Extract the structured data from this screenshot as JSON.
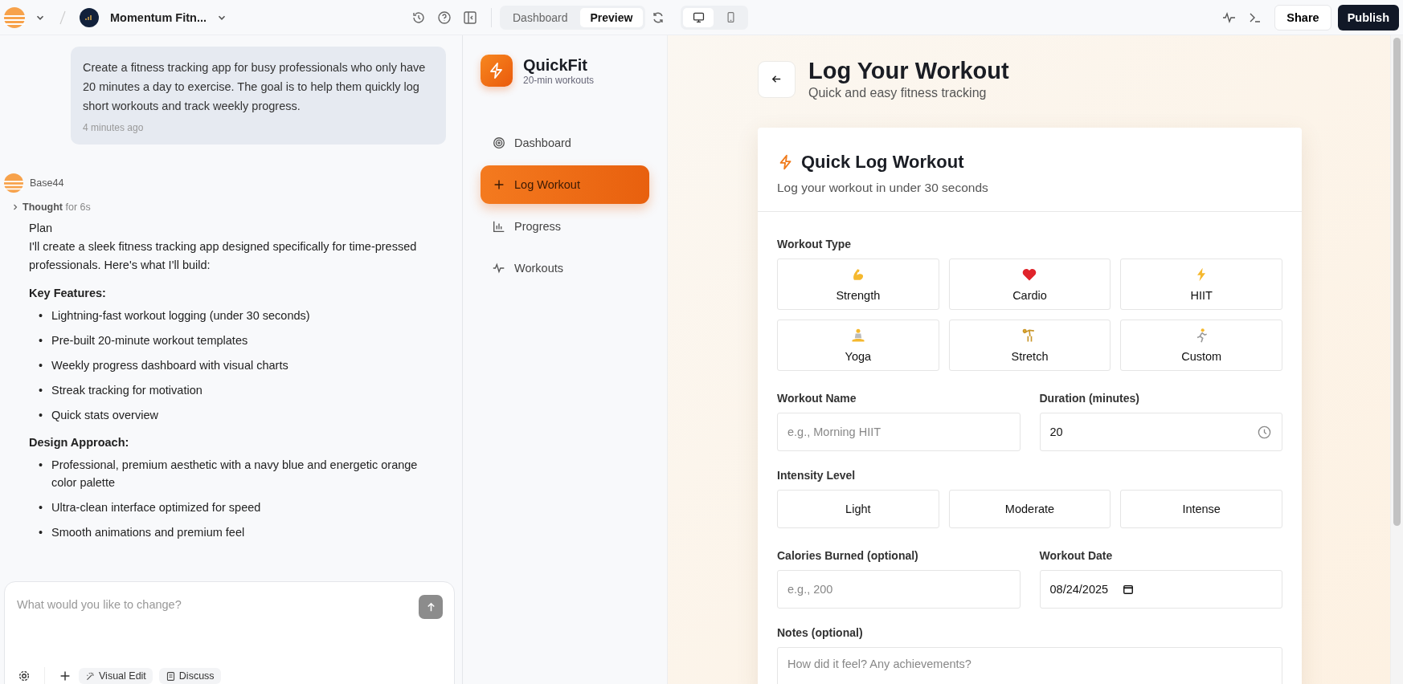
{
  "topbar": {
    "project": "Momentum Fitn...",
    "view_tabs": [
      {
        "label": "Dashboard",
        "selected": false
      },
      {
        "label": "Preview",
        "selected": true
      }
    ],
    "devices": [
      {
        "kind": "desktop",
        "selected": true
      },
      {
        "kind": "mobile",
        "selected": false
      }
    ],
    "share": "Share",
    "publish": "Publish"
  },
  "chat": {
    "user_message": "Create a fitness tracking app for busy professionals who only have 20 minutes a day to exercise. The goal is to help them quickly log short workouts and track weekly progress.",
    "time": "4 minutes ago",
    "assistant": "Base44",
    "thought": "**Thought** for 6s",
    "blocks": [
      {
        "kind": "text",
        "text": "Plan"
      },
      {
        "kind": "text",
        "text": "I'll create a sleek fitness tracking app designed specifically for time-pressed professionals. Here's what I'll build:"
      },
      {
        "kind": "heading",
        "text": "Key Features:"
      },
      {
        "kind": "bullets",
        "marker": "•",
        "items": [
          "Lightning-fast workout logging (under 30 seconds)",
          "Pre-built 20-minute workout templates",
          "Weekly progress dashboard with visual charts",
          "Streak tracking for motivation",
          "Quick stats overview"
        ]
      },
      {
        "kind": "heading",
        "text": "Design Approach:"
      },
      {
        "kind": "bullets",
        "marker": "•",
        "items": [
          "Professional, premium aesthetic with a navy blue and energetic orange color palette",
          "Ultra-clean interface optimized for speed",
          "Smooth animations and premium feel"
        ]
      }
    ],
    "input_placeholder": "What would you like to change?",
    "tools": [
      "Visual Edit",
      "Discuss"
    ]
  },
  "app": {
    "name": "QuickFit",
    "tagline": "20-min workouts",
    "nav": [
      {
        "kind": "target",
        "label": "Dashboard",
        "selected": false
      },
      {
        "kind": "plus",
        "label": "Log Workout",
        "selected": true
      },
      {
        "kind": "chart",
        "label": "Progress",
        "selected": false
      },
      {
        "kind": "activity",
        "label": "Workouts",
        "selected": false
      }
    ],
    "page_title": "Log Your Workout",
    "page_subtitle": "Quick and easy fitness tracking",
    "card": {
      "title": "Quick Log Workout",
      "subtitle": "Log your workout in under 30 seconds",
      "workout_type": {
        "label": "Workout Type",
        "options": [
          {
            "kind": "muscle",
            "label": "Strength",
            "selected": false
          },
          {
            "kind": "heart",
            "label": "Cardio",
            "selected": false
          },
          {
            "kind": "bolt",
            "label": "HIIT",
            "selected": false
          },
          {
            "kind": "yoga",
            "label": "Yoga",
            "selected": false
          },
          {
            "kind": "cartwheel",
            "label": "Stretch",
            "selected": false
          },
          {
            "kind": "runner",
            "label": "Custom",
            "selected": false
          }
        ]
      },
      "name_field": {
        "label": "Workout Name",
        "placeholder": "e.g., Morning HIIT"
      },
      "duration_field": {
        "label": "Duration (minutes)",
        "value": "20"
      },
      "intensity": {
        "label": "Intensity Level",
        "options": [
          {
            "label": "Light",
            "selected": false
          },
          {
            "label": "Moderate",
            "selected": false
          },
          {
            "label": "Intense",
            "selected": false
          }
        ]
      },
      "calories_field": {
        "label": "Calories Burned (optional)",
        "placeholder": "e.g., 200"
      },
      "date_field": {
        "label": "Workout Date",
        "value": "08/24/2025"
      },
      "notes_field": {
        "label": "Notes (optional)",
        "placeholder": "How did it feel? Any achievements?"
      }
    }
  }
}
